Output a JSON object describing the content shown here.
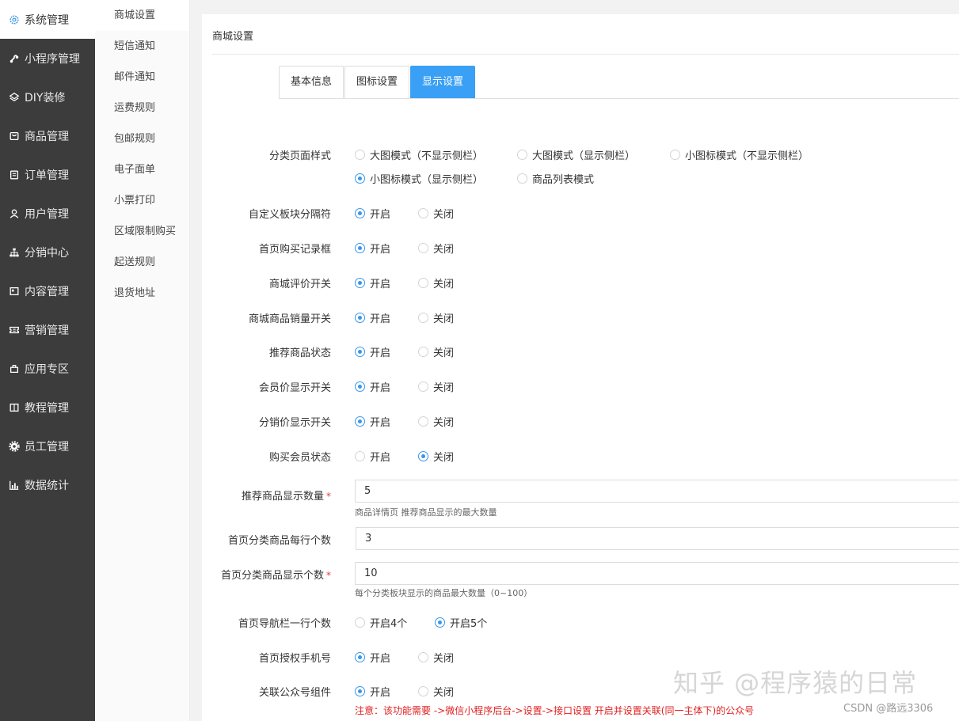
{
  "sidebar": {
    "items": [
      {
        "label": "系统管理",
        "icon": "gear-outline-icon"
      },
      {
        "label": "小程序管理",
        "icon": "mini-program-icon"
      },
      {
        "label": "DIY装修",
        "icon": "diy-layers-icon"
      },
      {
        "label": "商品管理",
        "icon": "goods-box-icon"
      },
      {
        "label": "订单管理",
        "icon": "order-clipboard-icon"
      },
      {
        "label": "用户管理",
        "icon": "user-icon"
      },
      {
        "label": "分销中心",
        "icon": "distribution-tree-icon"
      },
      {
        "label": "内容管理",
        "icon": "content-doc-icon"
      },
      {
        "label": "营销管理",
        "icon": "marketing-ticket-icon"
      },
      {
        "label": "应用专区",
        "icon": "apps-icon"
      },
      {
        "label": "教程管理",
        "icon": "book-icon"
      },
      {
        "label": "员工管理",
        "icon": "gear-solid-icon"
      },
      {
        "label": "数据统计",
        "icon": "bar-chart-icon"
      }
    ]
  },
  "submenu": {
    "items": [
      "商城设置",
      "短信通知",
      "邮件通知",
      "运费规则",
      "包邮规则",
      "电子面单",
      "小票打印",
      "区域限制购买",
      "起送规则",
      "退货地址"
    ]
  },
  "panel": {
    "title": "商城设置"
  },
  "tabs": [
    "基本信息",
    "图标设置",
    "显示设置"
  ],
  "form": {
    "category_style": {
      "label": "分类页面样式",
      "options": [
        "大图模式（不显示侧栏）",
        "大图模式（显示侧栏）",
        "小图标模式（不显示侧栏）",
        "小图标模式（显示侧栏）",
        "商品列表模式"
      ],
      "selected": "小图标模式（显示侧栏）"
    },
    "toggles": [
      {
        "label": "自定义板块分隔符",
        "on_label": "开启",
        "off_label": "关闭",
        "value": "开启"
      },
      {
        "label": "首页购买记录框",
        "on_label": "开启",
        "off_label": "关闭",
        "value": "开启"
      },
      {
        "label": "商城评价开关",
        "on_label": "开启",
        "off_label": "关闭",
        "value": "开启"
      },
      {
        "label": "商城商品销量开关",
        "on_label": "开启",
        "off_label": "关闭",
        "value": "开启"
      },
      {
        "label": "推荐商品状态",
        "on_label": "开启",
        "off_label": "关闭",
        "value": "开启"
      },
      {
        "label": "会员价显示开关",
        "on_label": "开启",
        "off_label": "关闭",
        "value": "开启"
      },
      {
        "label": "分销价显示开关",
        "on_label": "开启",
        "off_label": "关闭",
        "value": "开启"
      },
      {
        "label": "购买会员状态",
        "on_label": "开启",
        "off_label": "关闭",
        "value": "关闭"
      }
    ],
    "recommend_count": {
      "label": "推荐商品显示数量",
      "required": "*",
      "value": "5",
      "help": "商品详情页 推荐商品显示的最大数量"
    },
    "home_cat_per_row": {
      "label": "首页分类商品每行个数",
      "value": "3"
    },
    "home_cat_count": {
      "label": "首页分类商品显示个数",
      "required": "*",
      "value": "10",
      "help": "每个分类板块显示的商品最大数量（0~100）"
    },
    "nav_per_row": {
      "label": "首页导航栏一行个数",
      "opt1": "开启4个",
      "opt2": "开启5个",
      "value": "开启5个"
    },
    "auth_phone": {
      "label": "首页授权手机号",
      "on_label": "开启",
      "off_label": "关闭",
      "value": "开启"
    },
    "official_account": {
      "label": "关联公众号组件",
      "on_label": "开启",
      "off_label": "关闭",
      "value": "开启",
      "warning": "注意：该功能需要 ->微信小程序后台->设置->接口设置 开启并设置关联(同一主体下)的公众号"
    }
  },
  "watermark": "知乎 @程序猿的日常",
  "credit": "CSDN @路远3306",
  "colors": {
    "accent": "#3aa0f5",
    "radio": "#3a96e8",
    "sidebar": "#3c3c3c",
    "warning": "#e02020"
  }
}
